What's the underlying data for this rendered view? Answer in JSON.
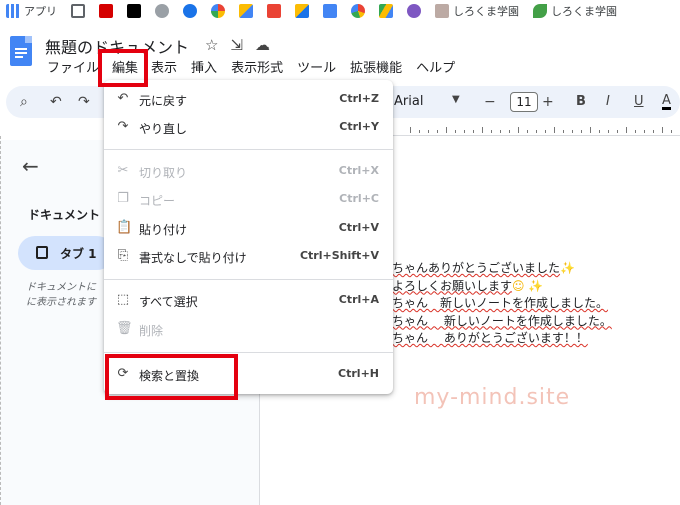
{
  "bookmarks": {
    "items": [
      {
        "label": "アプリ",
        "color": "#4285f4"
      },
      {
        "label": "",
        "color": "#5f6368"
      },
      {
        "label": "",
        "color": "#d50000"
      },
      {
        "label": "",
        "color": "#000000"
      },
      {
        "label": "",
        "color": "#9aa0a6"
      },
      {
        "label": "",
        "color": "#1a73e8"
      },
      {
        "label": "",
        "color": "#34a853"
      },
      {
        "label": "",
        "color": "#4285f4"
      },
      {
        "label": "",
        "color": "#ea4335"
      },
      {
        "label": "",
        "color": "#fbbc04"
      },
      {
        "label": "",
        "color": "#4285f4"
      },
      {
        "label": "",
        "color": "#4285f4"
      },
      {
        "label": "",
        "color": "#34a853"
      },
      {
        "label": "",
        "color": "#7e57c2"
      },
      {
        "label": "しろくま学園",
        "color": "#8d6e63"
      },
      {
        "label": "しろくま学園",
        "color": "#43a047"
      }
    ]
  },
  "doc": {
    "title": "無題のドキュメント"
  },
  "menubar": {
    "items": [
      "ファイル",
      "編集",
      "表示",
      "挿入",
      "表示形式",
      "ツール",
      "拡張機能",
      "ヘルプ"
    ]
  },
  "toolbar": {
    "font": "Arial",
    "font_size": "11",
    "minus": "−",
    "plus": "+",
    "bold": "B",
    "italic": "I",
    "underline": "U",
    "text_color": "A"
  },
  "left_panel": {
    "heading": "ドキュメント",
    "tab_label": "タブ 1",
    "note_line1": "ドキュメントに",
    "note_line2": "に表示されます"
  },
  "edit_menu": {
    "items": [
      {
        "icon": "undo-icon",
        "label": "元に戻す",
        "shortcut": "Ctrl+Z",
        "enabled": true
      },
      {
        "icon": "redo-icon",
        "label": "やり直し",
        "shortcut": "Ctrl+Y",
        "enabled": true
      },
      {
        "icon": "cut-icon",
        "label": "切り取り",
        "shortcut": "Ctrl+X",
        "enabled": false
      },
      {
        "icon": "copy-icon",
        "label": "コピー",
        "shortcut": "Ctrl+C",
        "enabled": false
      },
      {
        "icon": "paste-icon",
        "label": "貼り付け",
        "shortcut": "Ctrl+V",
        "enabled": true
      },
      {
        "icon": "paste-plain-icon",
        "label": "書式なしで貼り付け",
        "shortcut": "Ctrl+Shift+V",
        "enabled": true
      },
      {
        "icon": "select-all-icon",
        "label": "すべて選択",
        "shortcut": "Ctrl+A",
        "enabled": true
      },
      {
        "icon": "trash-icon",
        "label": "削除",
        "shortcut": "",
        "enabled": false
      },
      {
        "icon": "find-replace-icon",
        "label": "検索と置換",
        "shortcut": "Ctrl+H",
        "enabled": true
      }
    ]
  },
  "document_lines": [
    "こちゃんありがとうございました",
    "ろよろしくお願いします",
    "こちゃん　新しいノートを作成しました。",
    "こちゃん　 新しいノートを作成しました。",
    "こちゃん　 ありがとうございます！！"
  ],
  "watermark": "my-mind.site",
  "colors": {
    "highlight": "#e4000f",
    "accent": "#4285f4",
    "toolbar_bg": "#edf2fa",
    "tab_bg": "#d3e3fd"
  }
}
